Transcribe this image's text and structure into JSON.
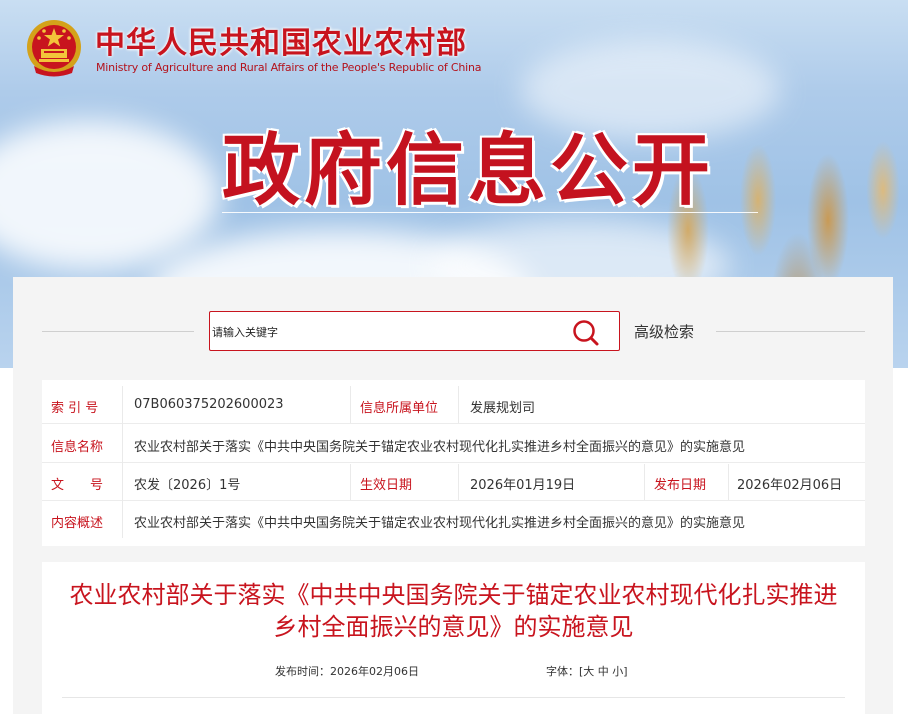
{
  "header": {
    "ministry_name_cn": "中华人民共和国农业农村部",
    "ministry_name_en": "Ministry of Agriculture and Rural Affairs of the People's Republic of China",
    "section_title": "政府信息公开",
    "brand_color": "#c8141e",
    "emblem_icon": "national-emblem-icon"
  },
  "search": {
    "placeholder": "请输入关键字",
    "advanced_label": "高级检索",
    "search_icon": "search-icon"
  },
  "info": {
    "index_label": "索 引 号",
    "index_value": "07B060375202600023",
    "unit_label": "信息所属单位",
    "unit_value": "发展规划司",
    "name_label": "信息名称",
    "name_value": "农业农村部关于落实《中共中央国务院关于锚定农业农村现代化扎实推进乡村全面振兴的意见》的实施意见",
    "docno_label": "文　　号",
    "docno_value": "农发〔2026〕1号",
    "effective_label": "生效日期",
    "effective_value": "2026年01月19日",
    "publish_label": "发布日期",
    "publish_value": "2026年02月06日",
    "summary_label": "内容概述",
    "summary_value": "农业农村部关于落实《中共中央国务院关于锚定农业农村现代化扎实推进乡村全面振兴的意见》的实施意见"
  },
  "article": {
    "title": "农业农村部关于落实《中共中央国务院关于锚定农业农村现代化扎实推进乡村全面振兴的意见》的实施意见",
    "publish_time_label": "发布时间：",
    "publish_time_value": "2026年02月06日",
    "font_label": "字体：",
    "font_open": "[",
    "font_large": "大",
    "font_medium": "中",
    "font_small": "小",
    "font_close": "]"
  }
}
